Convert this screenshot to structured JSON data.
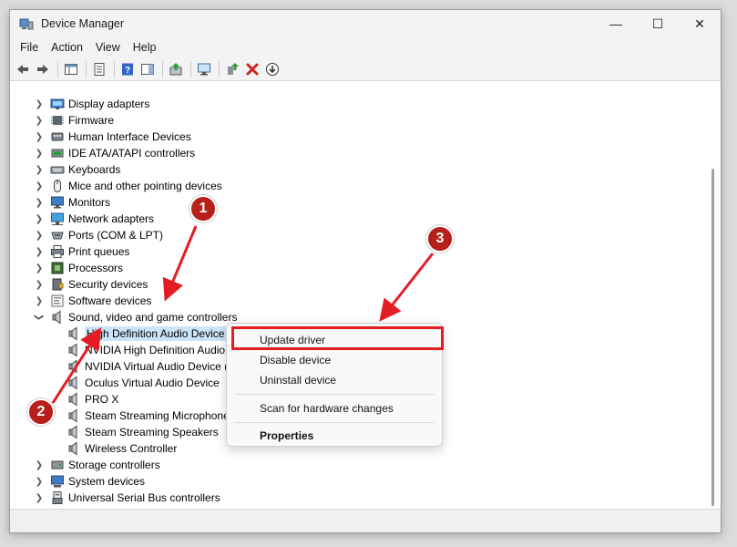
{
  "window": {
    "title": "Device Manager"
  },
  "window_controls": {
    "minimize": "—",
    "maximize": "☐",
    "close": "✕"
  },
  "menu": [
    "File",
    "Action",
    "View",
    "Help"
  ],
  "tree": {
    "categories_top": [
      {
        "label": "Display adapters",
        "icon": "display-adapter-icon"
      },
      {
        "label": "Firmware",
        "icon": "firmware-icon"
      },
      {
        "label": "Human Interface Devices",
        "icon": "hid-icon"
      },
      {
        "label": "IDE ATA/ATAPI controllers",
        "icon": "ide-controller-icon"
      },
      {
        "label": "Keyboards",
        "icon": "keyboard-icon"
      },
      {
        "label": "Mice and other pointing devices",
        "icon": "mouse-icon"
      },
      {
        "label": "Monitors",
        "icon": "monitor-icon"
      },
      {
        "label": "Network adapters",
        "icon": "network-adapter-icon"
      },
      {
        "label": "Ports (COM & LPT)",
        "icon": "port-icon"
      },
      {
        "label": "Print queues",
        "icon": "printer-icon"
      },
      {
        "label": "Processors",
        "icon": "processor-icon"
      },
      {
        "label": "Security devices",
        "icon": "security-device-icon"
      },
      {
        "label": "Software devices",
        "icon": "software-device-icon"
      }
    ],
    "expanded_category": {
      "label": "Sound, video and game controllers",
      "icon": "speaker-icon"
    },
    "children": [
      "High Definition Audio Device",
      "NVIDIA High Definition Audio",
      "NVIDIA Virtual Audio Device (",
      "Oculus Virtual Audio Device",
      "PRO X",
      "Steam Streaming Microphone",
      "Steam Streaming Speakers",
      "Wireless Controller"
    ],
    "categories_bottom": [
      {
        "label": "Storage controllers",
        "icon": "storage-controller-icon"
      },
      {
        "label": "System devices",
        "icon": "system-device-icon"
      },
      {
        "label": "Universal Serial Bus controllers",
        "icon": "usb-controller-icon"
      }
    ]
  },
  "context_menu": {
    "update_driver": "Update driver",
    "disable_device": "Disable device",
    "uninstall_device": "Uninstall device",
    "scan": "Scan for hardware changes",
    "properties": "Properties"
  },
  "annotations": {
    "one": "1",
    "two": "2",
    "three": "3"
  },
  "colors": {
    "annotation_red": "#e51c23",
    "badge_red": "#b71f1a",
    "selection": "#cce4f7"
  }
}
